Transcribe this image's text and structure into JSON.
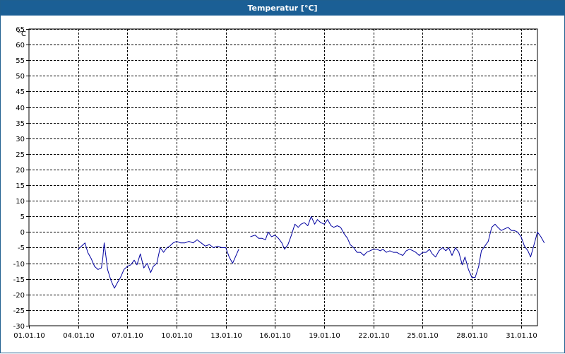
{
  "window": {
    "title": "Temperatur [°C]"
  },
  "chart_data": {
    "type": "line",
    "title": "Temperatur [°C]",
    "ylabel": "°C",
    "xlabel": "",
    "ylim": [
      -30,
      65
    ],
    "yticks": [
      -30,
      -25,
      -20,
      -15,
      -10,
      -5,
      0,
      5,
      10,
      15,
      20,
      25,
      30,
      35,
      40,
      45,
      50,
      55,
      60,
      65
    ],
    "xlim": [
      "2010-01-01",
      "2010-02-01"
    ],
    "xtick_labels": [
      "01.01.10",
      "04.01.10",
      "07.01.10",
      "10.01.10",
      "13.01.10",
      "16.01.10",
      "19.01.10",
      "22.01.10",
      "25.01.10",
      "28.01.10",
      "31.01.10"
    ],
    "xtick_dates": [
      "2010-01-01",
      "2010-01-04",
      "2010-01-07",
      "2010-01-10",
      "2010-01-13",
      "2010-01-16",
      "2010-01-19",
      "2010-01-22",
      "2010-01-25",
      "2010-01-28",
      "2010-01-31"
    ],
    "grid": true,
    "line_color": "#0000a0",
    "segments": [
      [
        [
          "2010-01-04 00:00",
          -5.5
        ],
        [
          "2010-01-04 05:00",
          -4.5
        ],
        [
          "2010-01-04 10:00",
          -3.5
        ],
        [
          "2010-01-04 14:00",
          -6.5
        ],
        [
          "2010-01-04 19:00",
          -8.5
        ],
        [
          "2010-01-05 00:00",
          -11
        ],
        [
          "2010-01-05 05:00",
          -12
        ],
        [
          "2010-01-05 10:00",
          -11.5
        ],
        [
          "2010-01-05 12:00",
          -8.5
        ],
        [
          "2010-01-05 14:00",
          -3.5
        ],
        [
          "2010-01-05 17:00",
          -8.5
        ],
        [
          "2010-01-05 19:00",
          -12
        ],
        [
          "2010-01-06 00:00",
          -15.5
        ],
        [
          "2010-01-06 05:00",
          -18
        ],
        [
          "2010-01-06 10:00",
          -16
        ],
        [
          "2010-01-06 14:00",
          -14.5
        ],
        [
          "2010-01-06 19:00",
          -12
        ],
        [
          "2010-01-07 00:00",
          -11
        ],
        [
          "2010-01-07 05:00",
          -10.5
        ],
        [
          "2010-01-07 10:00",
          -9
        ],
        [
          "2010-01-07 14:00",
          -10.5
        ],
        [
          "2010-01-07 19:00",
          -7
        ],
        [
          "2010-01-08 00:00",
          -11.5
        ],
        [
          "2010-01-08 05:00",
          -10
        ],
        [
          "2010-01-08 10:00",
          -13
        ],
        [
          "2010-01-08 14:00",
          -11
        ],
        [
          "2010-01-08 19:00",
          -10
        ],
        [
          "2010-01-09 00:00",
          -5
        ],
        [
          "2010-01-09 05:00",
          -6.5
        ],
        [
          "2010-01-09 10:00",
          -5
        ],
        [
          "2010-01-09 14:00",
          -4.5
        ],
        [
          "2010-01-09 19:00",
          -3.5
        ],
        [
          "2010-01-10 00:00",
          -3
        ],
        [
          "2010-01-10 06:00",
          -3.5
        ],
        [
          "2010-01-10 12:00",
          -3.5
        ],
        [
          "2010-01-10 18:00",
          -3
        ],
        [
          "2010-01-11 00:00",
          -3.5
        ],
        [
          "2010-01-11 06:00",
          -2.5
        ],
        [
          "2010-01-11 12:00",
          -3.5
        ],
        [
          "2010-01-11 18:00",
          -4.5
        ],
        [
          "2010-01-12 00:00",
          -4
        ],
        [
          "2010-01-12 06:00",
          -5
        ],
        [
          "2010-01-12 12:00",
          -4.5
        ],
        [
          "2010-01-12 18:00",
          -5
        ],
        [
          "2010-01-13 00:00",
          -5
        ],
        [
          "2010-01-13 05:00",
          -8
        ],
        [
          "2010-01-13 10:00",
          -10
        ],
        [
          "2010-01-13 14:00",
          -8
        ],
        [
          "2010-01-13 19:00",
          -5.5
        ]
      ],
      [
        [
          "2010-01-14 12:00",
          -1.5
        ],
        [
          "2010-01-14 19:00",
          -1
        ],
        [
          "2010-01-15 00:00",
          -2
        ],
        [
          "2010-01-15 05:00",
          -2
        ],
        [
          "2010-01-15 10:00",
          -2.5
        ],
        [
          "2010-01-15 14:00",
          0
        ],
        [
          "2010-01-15 19:00",
          -1.5
        ],
        [
          "2010-01-16 00:00",
          -1
        ],
        [
          "2010-01-16 05:00",
          -2
        ],
        [
          "2010-01-16 10:00",
          -3.5
        ],
        [
          "2010-01-16 14:00",
          -5.5
        ],
        [
          "2010-01-16 19:00",
          -4
        ],
        [
          "2010-01-17 00:00",
          -1
        ],
        [
          "2010-01-17 05:00",
          2.5
        ],
        [
          "2010-01-17 10:00",
          1.5
        ],
        [
          "2010-01-17 14:00",
          2.5
        ],
        [
          "2010-01-17 19:00",
          3
        ],
        [
          "2010-01-18 00:00",
          2
        ],
        [
          "2010-01-18 05:00",
          5
        ],
        [
          "2010-01-18 10:00",
          2.5
        ],
        [
          "2010-01-18 14:00",
          4
        ],
        [
          "2010-01-18 19:00",
          3
        ],
        [
          "2010-01-19 00:00",
          2.5
        ],
        [
          "2010-01-19 05:00",
          4
        ],
        [
          "2010-01-19 10:00",
          2
        ],
        [
          "2010-01-19 14:00",
          1.5
        ],
        [
          "2010-01-19 19:00",
          2
        ],
        [
          "2010-01-20 00:00",
          1.5
        ],
        [
          "2010-01-20 05:00",
          -0.5
        ],
        [
          "2010-01-20 10:00",
          -2
        ],
        [
          "2010-01-20 14:00",
          -4
        ],
        [
          "2010-01-20 19:00",
          -5
        ],
        [
          "2010-01-21 00:00",
          -6.5
        ],
        [
          "2010-01-21 05:00",
          -6.5
        ],
        [
          "2010-01-21 10:00",
          -7.5
        ],
        [
          "2010-01-21 14:00",
          -6.5
        ],
        [
          "2010-01-21 19:00",
          -6
        ],
        [
          "2010-01-22 00:00",
          -5.5
        ],
        [
          "2010-01-22 05:00",
          -5.5
        ],
        [
          "2010-01-22 10:00",
          -6
        ],
        [
          "2010-01-22 14:00",
          -5.5
        ],
        [
          "2010-01-22 19:00",
          -6.5
        ],
        [
          "2010-01-23 00:00",
          -6
        ],
        [
          "2010-01-23 05:00",
          -6.5
        ],
        [
          "2010-01-23 10:00",
          -6.5
        ],
        [
          "2010-01-23 14:00",
          -7
        ],
        [
          "2010-01-23 19:00",
          -7.5
        ],
        [
          "2010-01-24 00:00",
          -6
        ],
        [
          "2010-01-24 05:00",
          -5.5
        ],
        [
          "2010-01-24 10:00",
          -6
        ],
        [
          "2010-01-24 14:00",
          -6.5
        ],
        [
          "2010-01-24 19:00",
          -7.5
        ],
        [
          "2010-01-25 00:00",
          -6.5
        ],
        [
          "2010-01-25 05:00",
          -6.5
        ],
        [
          "2010-01-25 10:00",
          -5.5
        ],
        [
          "2010-01-25 14:00",
          -7
        ],
        [
          "2010-01-25 19:00",
          -8
        ],
        [
          "2010-01-26 00:00",
          -6
        ],
        [
          "2010-01-26 05:00",
          -5
        ],
        [
          "2010-01-26 10:00",
          -6
        ],
        [
          "2010-01-26 14:00",
          -5
        ],
        [
          "2010-01-26 19:00",
          -7.5
        ],
        [
          "2010-01-27 00:00",
          -5
        ],
        [
          "2010-01-27 05:00",
          -6.5
        ],
        [
          "2010-01-27 10:00",
          -10.5
        ],
        [
          "2010-01-27 14:00",
          -8
        ],
        [
          "2010-01-27 19:00",
          -12
        ],
        [
          "2010-01-28 00:00",
          -14.5
        ],
        [
          "2010-01-28 05:00",
          -14.5
        ],
        [
          "2010-01-28 10:00",
          -11
        ],
        [
          "2010-01-28 14:00",
          -6
        ],
        [
          "2010-01-28 19:00",
          -4.5
        ],
        [
          "2010-01-29 00:00",
          -3
        ],
        [
          "2010-01-29 05:00",
          1.5
        ],
        [
          "2010-01-29 10:00",
          2.5
        ],
        [
          "2010-01-29 14:00",
          1.5
        ],
        [
          "2010-01-29 19:00",
          0.5
        ],
        [
          "2010-01-30 00:00",
          1
        ],
        [
          "2010-01-30 05:00",
          1.5
        ],
        [
          "2010-01-30 10:00",
          0.5
        ],
        [
          "2010-01-30 14:00",
          0.5
        ],
        [
          "2010-01-30 19:00",
          0
        ],
        [
          "2010-01-31 00:00",
          -1.5
        ],
        [
          "2010-01-31 05:00",
          -4.5
        ],
        [
          "2010-01-31 10:00",
          -6
        ],
        [
          "2010-01-31 14:00",
          -8
        ],
        [
          "2010-01-31 19:00",
          -4
        ],
        [
          "2010-02-01 00:00",
          0
        ],
        [
          "2010-02-01 05:00",
          -1.5
        ],
        [
          "2010-02-01 10:00",
          -3.5
        ]
      ]
    ]
  }
}
